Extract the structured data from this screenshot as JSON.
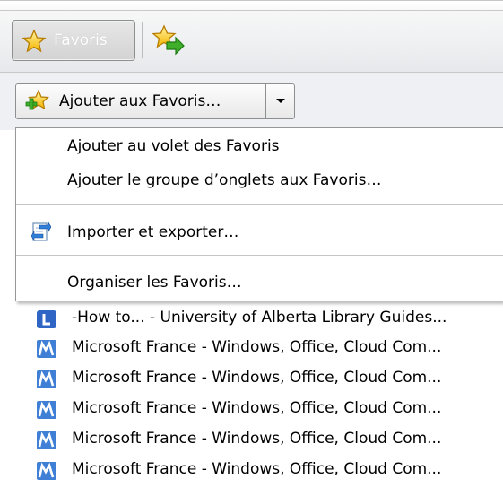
{
  "favorites_bar": {
    "favoris_label": "Favoris"
  },
  "add_split": {
    "label": "Ajouter aux Favoris…"
  },
  "menu": {
    "items": [
      "Ajouter au volet des Favoris",
      "Ajouter le groupe d’onglets aux Favoris…",
      "Importer et exporter…",
      "Organiser les Favoris…"
    ]
  },
  "favorites_list": [
    "-How to... - University of Alberta Library Guides...",
    "Microsoft France - Windows, Office, Cloud Com...",
    "Microsoft France - Windows, Office, Cloud Com...",
    "Microsoft France - Windows, Office, Cloud Com...",
    "Microsoft France - Windows, Office, Cloud Com...",
    "Microsoft France - Windows, Office, Cloud Com..."
  ],
  "icons": {
    "favorites_star": "star-icon",
    "add_to_favbar": "add-to-favorites-bar-icon",
    "add_favorite": "star-add-icon",
    "import_export": "import-export-icon",
    "library_site": "library-favicon",
    "microsoft_site": "microsoft-favicon"
  },
  "colors": {
    "star_gold": "#f4b400",
    "add_green": "#3fae2a",
    "microsoft_blue": "#3f7fd6",
    "library_blue": "#2f66c6"
  }
}
